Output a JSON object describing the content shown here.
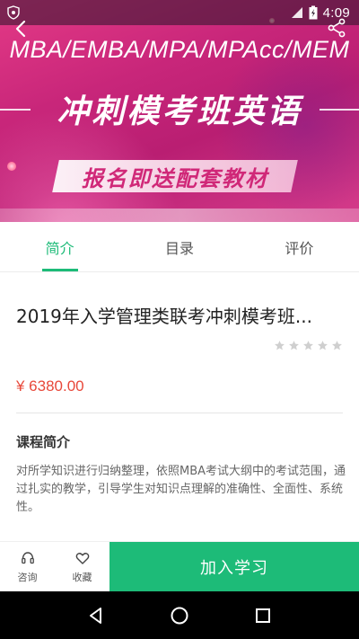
{
  "status_bar": {
    "time": "4:09",
    "icons": [
      "shield-icon",
      "signal-icon",
      "battery-charging-icon"
    ]
  },
  "banner": {
    "topline": "MBA/EMBA/MPA/MPAcc/MEM",
    "title": "冲刺模考班英语",
    "subtitle": "报名即送配套教材"
  },
  "header": {
    "icons": [
      "back-arrow-icon",
      "share-icon"
    ]
  },
  "tabs": [
    {
      "label": "简介",
      "active": true
    },
    {
      "label": "目录",
      "active": false
    },
    {
      "label": "评价",
      "active": false
    }
  ],
  "course": {
    "title": "2019年入学管理类联考冲刺模考班...",
    "rating_stars": 0,
    "rating_max": 5,
    "price": "¥ 6380.00"
  },
  "intro": {
    "heading": "课程简介",
    "text": "对所学知识进行归纳整理，依照MBA考试大纲中的考试范围，通过扎实的教学，引导学生对知识点理解的准确性、全面性、系统性。"
  },
  "actions": {
    "consult_label": "咨询",
    "favorite_label": "收藏",
    "join_label": "加入学习"
  },
  "colors": {
    "accent": "#1dbb78",
    "price": "#e8483a",
    "banner": "#c8267a"
  }
}
